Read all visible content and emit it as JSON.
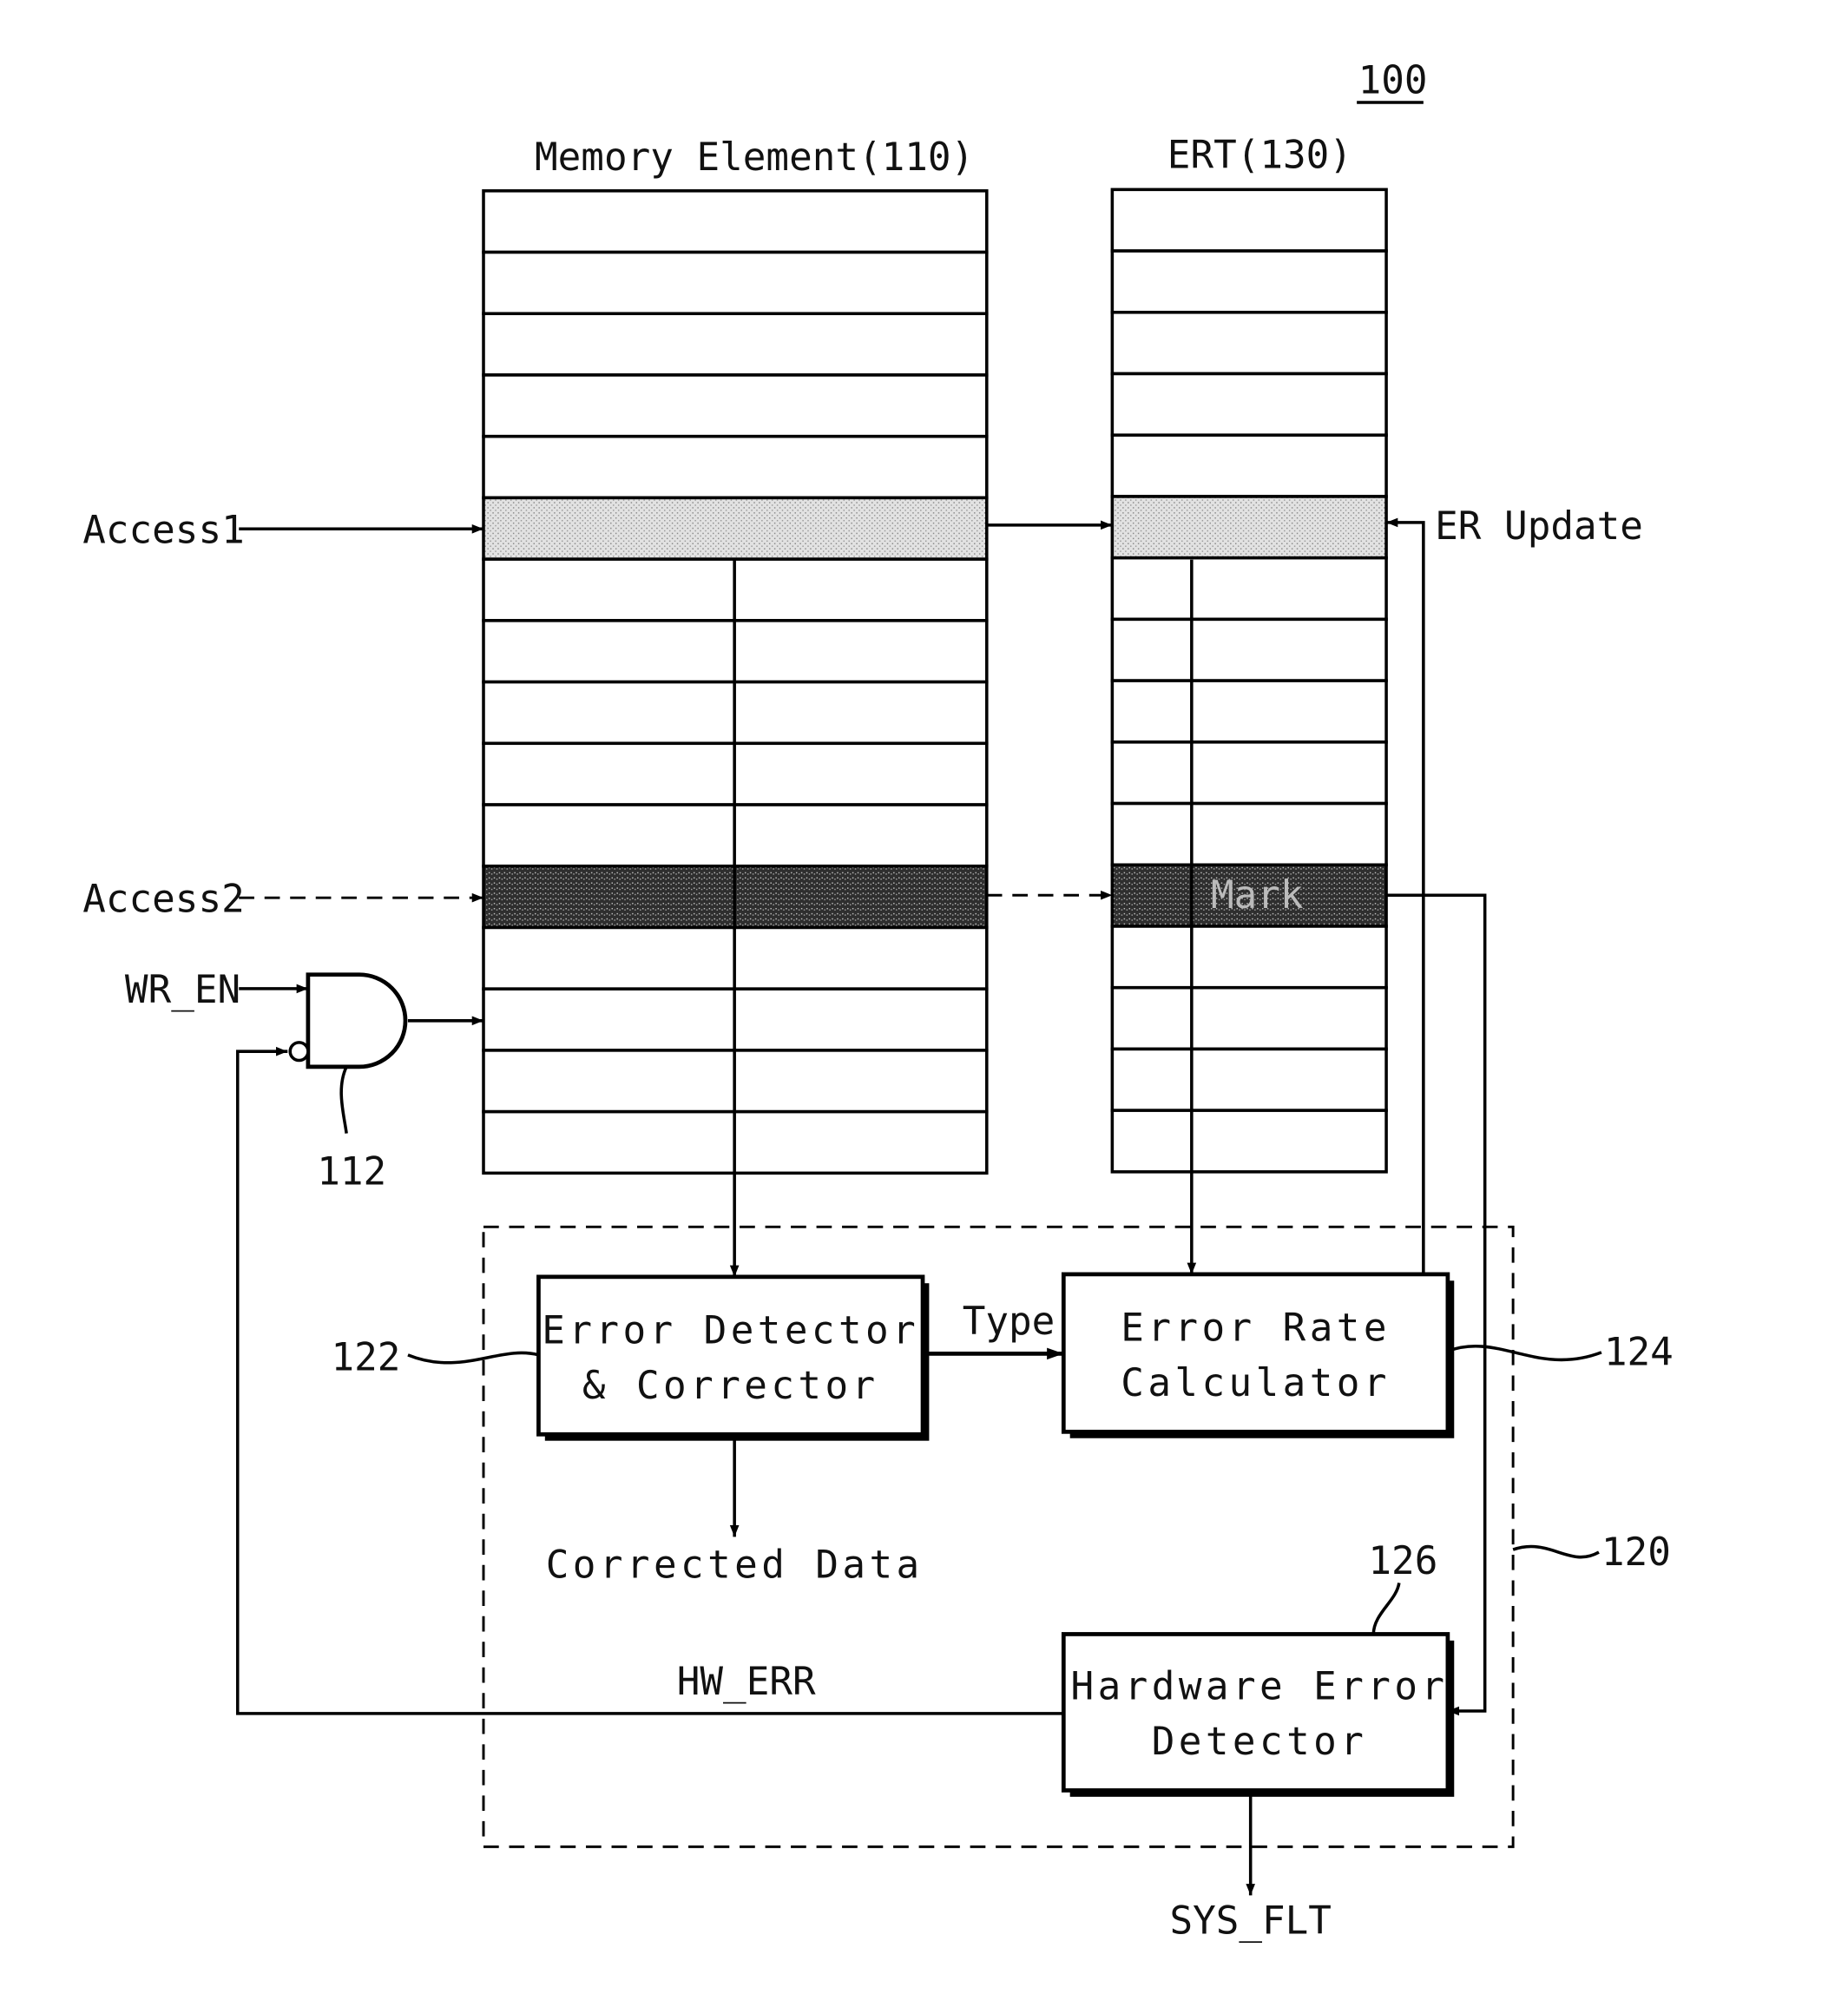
{
  "figure": {
    "reference": "100",
    "colors": {
      "line": "#000000",
      "background": "#ffffff",
      "light_shade": "#d4d4d4",
      "dark_shade": "#3a3a3a"
    }
  },
  "memory_element": {
    "title": "Memory Element(110)",
    "row_count": 16,
    "access1_row": 6,
    "access2_row": 12,
    "write_row": 13
  },
  "ert": {
    "title": "ERT(130)",
    "row_count": 16,
    "access1_row": 6,
    "access2_row": 12,
    "mark_label": "Mark"
  },
  "signals": {
    "access1": "Access1",
    "access2": "Access2",
    "wr_en": "WR_EN",
    "er_update": "ER Update",
    "type": "Type",
    "corrected_data": "Corrected Data",
    "hw_err": "HW_ERR",
    "sys_flt": "SYS_FLT"
  },
  "gate": {
    "reference": "112",
    "type": "AND with inverted input"
  },
  "controller": {
    "reference": "120",
    "blocks": {
      "error_detector": {
        "line1": "Error Detector",
        "line2": "& Corrector",
        "reference": "122"
      },
      "error_rate_calculator": {
        "line1": "Error Rate",
        "line2": "Calculator",
        "reference": "124"
      },
      "hardware_error_detector": {
        "line1": "Hardware Error",
        "line2": "Detector",
        "reference": "126"
      }
    }
  }
}
